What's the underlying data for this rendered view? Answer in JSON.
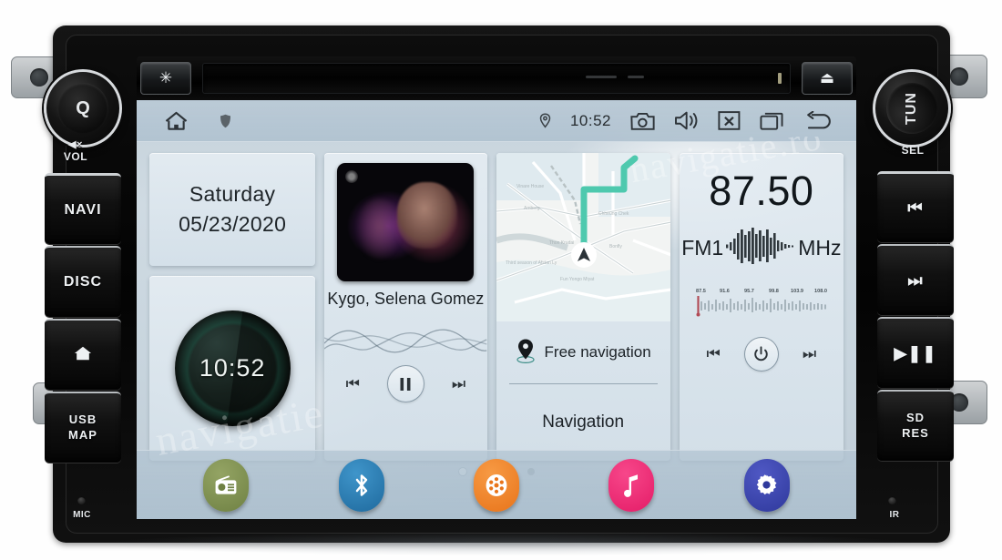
{
  "device": {
    "brand_knob_left": "Q",
    "brand_knob_right": "TUN",
    "left_labels": {
      "vol": "VOL",
      "mic": "MIC"
    },
    "right_labels": {
      "sel": "SEL",
      "ir": "IR"
    },
    "left_buttons": [
      {
        "label": "NAVI",
        "icon": "",
        "name": "navi"
      },
      {
        "label": "DISC",
        "icon": "",
        "name": "disc"
      },
      {
        "label": "",
        "icon": "home-icon",
        "name": "home"
      },
      {
        "label": "USB\nMAP",
        "icon": "",
        "name": "usb-map"
      }
    ],
    "right_buttons": [
      {
        "label": "",
        "icon": "previous-track-icon",
        "name": "previous"
      },
      {
        "label": "",
        "icon": "next-track-icon",
        "name": "next"
      },
      {
        "label": "",
        "icon": "play-pause-icon",
        "name": "play-pause"
      },
      {
        "label": "SD\nRES",
        "icon": "",
        "name": "sd-res"
      }
    ],
    "top_bar": {
      "brightness_icon": "asterisk-icon",
      "eject_icon": "eject-icon",
      "disc_slot": "cd-slot"
    }
  },
  "statusbar": {
    "home_icon": "home-icon",
    "shield_icon": "shield-icon",
    "location_icon": "location-pin-icon",
    "time": "10:52",
    "camera_icon": "camera-icon",
    "volume_icon": "volume-icon",
    "close_icon": "close-box-icon",
    "recents_icon": "recents-icon",
    "back_icon": "back-arrow-icon"
  },
  "widgets": {
    "date": {
      "day": "Saturday",
      "date": "05/23/2020"
    },
    "clock": {
      "time": "10:52"
    },
    "music": {
      "artist": "Kygo, Selena Gomez",
      "prev_icon": "previous-track-icon",
      "pause_icon": "pause-icon",
      "next_icon": "next-track-icon"
    },
    "navigation": {
      "free_nav_label": "Free navigation",
      "title": "Navigation",
      "pin_icon": "map-pin-icon",
      "marker_icon": "navigation-arrow-icon",
      "route_color": "#4ec9ae",
      "map_labels": [
        "Vinare House",
        "Amberg",
        "Thon Krudai",
        "Chheung Chek",
        "Bonfly",
        "Third season of Afstan Ly",
        "Fun Yongo Miyat"
      ]
    },
    "radio": {
      "frequency": "87.50",
      "band": "FM1",
      "unit": "MHz",
      "scale_labels": [
        "87.5",
        "91.6",
        "95.7",
        "99.8",
        "103.9",
        "108.0"
      ],
      "tuned_position_pct": 4,
      "prev_icon": "previous-track-icon",
      "power_icon": "power-icon",
      "next_icon": "next-track-icon"
    }
  },
  "page_indicator": {
    "count": 4,
    "active": 0
  },
  "dock": [
    {
      "name": "radio",
      "icon": "radio-icon",
      "color": "#7d8e4e"
    },
    {
      "name": "bluetooth",
      "icon": "bluetooth-icon",
      "color": "#2b7cb4"
    },
    {
      "name": "video",
      "icon": "film-reel-icon",
      "color": "#ef7f1f"
    },
    {
      "name": "music",
      "icon": "music-note-icon",
      "color": "#ee2a72"
    },
    {
      "name": "settings",
      "icon": "gear-icon",
      "color": "#3b44b0"
    }
  ],
  "watermark": {
    "line1": "navigatie",
    "line2": "navigatie.ro"
  }
}
